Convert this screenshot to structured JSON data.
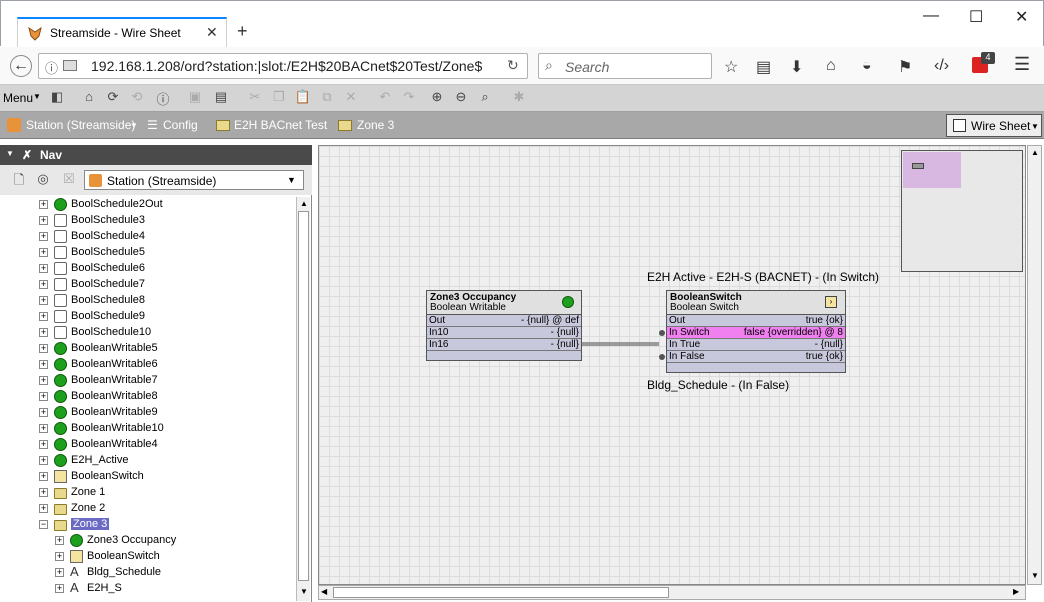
{
  "browser": {
    "tab_title": "Streamside - Wire Sheet",
    "url": "192.168.1.208/ord?station:|slot:/E2H$20BACnet$20Test/Zone$",
    "search_placeholder": "Search",
    "badge_count": "4"
  },
  "toolbar": {
    "menu_label": "Menu"
  },
  "breadcrumbs": [
    "Station (Streamside)",
    "Config",
    "E2H BACnet Test",
    "Zone 3"
  ],
  "view_selector": "Wire Sheet",
  "nav": {
    "title": "Nav",
    "station": "Station (Streamside)",
    "tree": [
      {
        "label": "BoolSchedule2Out",
        "icon": "green-dot",
        "depth": 0
      },
      {
        "label": "BoolSchedule3",
        "icon": "schedule",
        "depth": 0
      },
      {
        "label": "BoolSchedule4",
        "icon": "schedule",
        "depth": 0
      },
      {
        "label": "BoolSchedule5",
        "icon": "schedule",
        "depth": 0
      },
      {
        "label": "BoolSchedule6",
        "icon": "schedule",
        "depth": 0
      },
      {
        "label": "BoolSchedule7",
        "icon": "schedule",
        "depth": 0
      },
      {
        "label": "BoolSchedule8",
        "icon": "schedule",
        "depth": 0
      },
      {
        "label": "BoolSchedule9",
        "icon": "schedule",
        "depth": 0
      },
      {
        "label": "BoolSchedule10",
        "icon": "schedule",
        "depth": 0
      },
      {
        "label": "BooleanWritable5",
        "icon": "green-dot",
        "depth": 0
      },
      {
        "label": "BooleanWritable6",
        "icon": "green-dot",
        "depth": 0
      },
      {
        "label": "BooleanWritable7",
        "icon": "green-dot",
        "depth": 0
      },
      {
        "label": "BooleanWritable8",
        "icon": "green-dot",
        "depth": 0
      },
      {
        "label": "BooleanWritable9",
        "icon": "green-dot",
        "depth": 0
      },
      {
        "label": "BooleanWritable10",
        "icon": "green-dot",
        "depth": 0
      },
      {
        "label": "BooleanWritable4",
        "icon": "green-dot",
        "depth": 0
      },
      {
        "label": "E2H_Active",
        "icon": "green-dot",
        "depth": 0
      },
      {
        "label": "BooleanSwitch",
        "icon": "switch",
        "depth": 0
      },
      {
        "label": "Zone 1",
        "icon": "folder",
        "depth": 0
      },
      {
        "label": "Zone 2",
        "icon": "folder",
        "depth": 0
      },
      {
        "label": "Zone 3",
        "icon": "folder",
        "depth": 0,
        "selected": true,
        "expanded": true
      },
      {
        "label": "Zone3 Occupancy",
        "icon": "green-dot",
        "depth": 1
      },
      {
        "label": "BooleanSwitch",
        "icon": "switch",
        "depth": 1
      },
      {
        "label": "Bldg_Schedule",
        "icon": "link",
        "depth": 1
      },
      {
        "label": "E2H_S",
        "icon": "link",
        "depth": 1
      }
    ]
  },
  "wiresheet": {
    "occupancy": {
      "name": "Zone3 Occupancy",
      "type": "Boolean Writable",
      "slots": [
        {
          "k": "Out",
          "v": "- {null} @ def"
        },
        {
          "k": "In10",
          "v": "- {null}"
        },
        {
          "k": "In16",
          "v": "- {null}"
        }
      ]
    },
    "switch": {
      "name": "BooleanSwitch",
      "type": "Boolean Switch",
      "slots": [
        {
          "k": "Out",
          "v": "true {ok}"
        },
        {
          "k": "In Switch",
          "v": "false {overridden} @ 8"
        },
        {
          "k": "In True",
          "v": "- {null}"
        },
        {
          "k": "In False",
          "v": "true {ok}"
        }
      ]
    },
    "label_top": "E2H Active - E2H-S (BACNET) - (In Switch)",
    "label_bottom": "Bldg_Schedule - (In False)"
  }
}
